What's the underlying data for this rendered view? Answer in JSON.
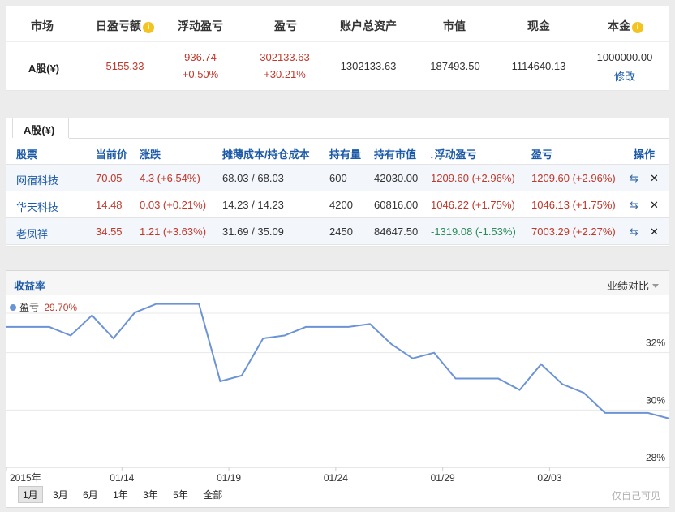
{
  "summary": {
    "headers": {
      "market": "市场",
      "daily_pnl": "日盈亏额",
      "floating_pnl": "浮动盈亏",
      "pnl": "盈亏",
      "total_assets": "账户总资产",
      "market_value": "市值",
      "cash": "现金",
      "principal": "本金"
    },
    "row": {
      "market": "A股(¥)",
      "daily_pnl": "5155.33",
      "floating_pnl": "936.74",
      "floating_pnl_pct": "+0.50%",
      "pnl": "302133.63",
      "pnl_pct": "+30.21%",
      "total_assets": "1302133.63",
      "market_value": "187493.50",
      "cash": "1114640.13",
      "principal": "1000000.00",
      "edit_link": "修改"
    },
    "info_icon_glyph": "i"
  },
  "holdings": {
    "tab_label": "A股(¥)",
    "columns": {
      "stock": "股票",
      "price": "当前价",
      "change": "涨跌",
      "cost": "摊薄成本/持仓成本",
      "quantity": "持有量",
      "holding_value": "持有市值",
      "floating_pnl": "↓浮动盈亏",
      "pnl": "盈亏",
      "actions": "操作"
    },
    "rows": [
      {
        "name": "网宿科技",
        "price": "70.05",
        "change": "4.3 (+6.54%)",
        "cost": "68.03 / 68.03",
        "quantity": "600",
        "holding_value": "42030.00",
        "floating_pnl": "1209.60 (+2.96%)",
        "pnl": "1209.60 (+2.96%)"
      },
      {
        "name": "华天科技",
        "price": "14.48",
        "change": "0.03 (+0.21%)",
        "cost": "14.23 / 14.23",
        "quantity": "4200",
        "holding_value": "60816.00",
        "floating_pnl": "1046.22 (+1.75%)",
        "pnl": "1046.13 (+1.75%)"
      },
      {
        "name": "老凤祥",
        "price": "34.55",
        "change": "1.21 (+3.63%)",
        "cost": "31.69 / 35.09",
        "quantity": "2450",
        "holding_value": "84647.50",
        "floating_pnl": "-1319.08 (-1.53%)",
        "pnl": "7003.29 (+2.27%)"
      }
    ],
    "action_icons": [
      "swap-icon",
      "close-icon"
    ]
  },
  "chart_panel": {
    "title": "收益率",
    "compare_label": "业绩对比",
    "legend_name": "盈亏",
    "legend_value": "29.70%",
    "ranges": [
      "1月",
      "3月",
      "6月",
      "1年",
      "3年",
      "5年",
      "全部"
    ],
    "active_range": "1月",
    "private_note": "仅自己可见"
  },
  "chart_data": {
    "type": "line",
    "series": [
      {
        "name": "盈亏",
        "values": [
          32.9,
          32.9,
          32.9,
          32.6,
          33.3,
          32.5,
          33.4,
          33.7,
          33.7,
          33.7,
          31.0,
          31.2,
          32.5,
          32.6,
          32.9,
          32.9,
          32.9,
          33.0,
          32.3,
          31.8,
          32.0,
          31.1,
          31.1,
          31.1,
          30.7,
          31.6,
          30.9,
          30.6,
          29.9,
          29.9,
          29.9,
          29.7
        ]
      }
    ],
    "x_tick_labels": [
      "2015年",
      "01/14",
      "01/19",
      "01/24",
      "01/29",
      "02/03"
    ],
    "y_tick_labels": [
      "32%",
      "30%",
      "28%"
    ],
    "yticks": [
      32,
      30,
      28
    ],
    "ylim": [
      28,
      34
    ],
    "grid": true,
    "line_color": "#6b93d6"
  },
  "colors": {
    "positive": "#c0392b",
    "negative": "#2e8b57",
    "link": "#1c5aa8",
    "info_icon": "#f3c320"
  }
}
